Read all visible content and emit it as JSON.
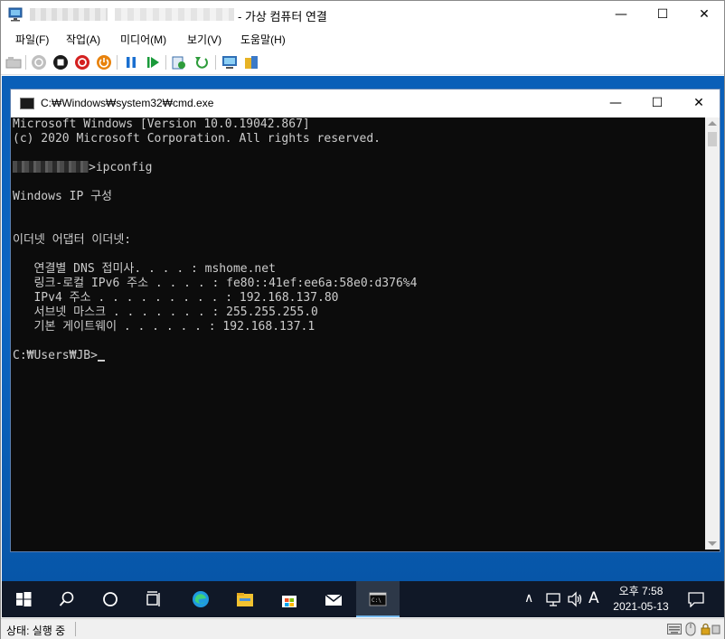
{
  "outer_window": {
    "title": "- 가상 컴퓨터 연결",
    "minimize": "—",
    "maximize": "☐",
    "close": "✕"
  },
  "menu": {
    "items": [
      "파일(F)",
      "작업(A)",
      "미디어(M)",
      "보기(V)",
      "도움말(H)"
    ]
  },
  "toolbar": {
    "icons": [
      "ctrl-alt-del-icon",
      "start-icon",
      "turn-off-icon",
      "shut-down-icon",
      "save-icon",
      "power-icon",
      "pause-icon",
      "resume-icon",
      "checkpoint-icon",
      "revert-icon",
      "enhanced-session-icon",
      "share-icon"
    ]
  },
  "cmd_window": {
    "title": "C:₩Windows₩system32₩cmd.exe",
    "minimize": "—",
    "maximize": "☐",
    "close": "✕"
  },
  "console": {
    "line1": "Microsoft Windows [Version 10.0.19042.867]",
    "line2": "(c) 2020 Microsoft Corporation. All rights reserved.",
    "prompt1_command": ">ipconfig",
    "line4": "Windows IP 구성",
    "line5": "이더넷 어댑터 이더넷:",
    "dns_suffix": "   연결별 DNS 접미사. . . . : mshome.net",
    "ipv6": "   링크-로컬 IPv6 주소 . . . . : fe80::41ef:ee6a:58e0:d376%4",
    "ipv4": "   IPv4 주소 . . . . . . . . . : 192.168.137.80",
    "subnet": "   서브넷 마스크 . . . . . . . : 255.255.255.0",
    "gateway": "   기본 게이트웨이 . . . . . . : 192.168.137.1",
    "prompt2": "C:₩Users₩JB>"
  },
  "taskbar": {
    "clock_time": "오후 7:58",
    "clock_date": "2021-05-13",
    "ime": "A",
    "tray_chevron": "∧"
  },
  "status": {
    "text": "상태: 실행 중"
  },
  "colors": {
    "desktop_blue": "#0b66c4",
    "taskbar": "#101827",
    "console_bg": "#0c0c0c",
    "console_fg": "#cccccc"
  }
}
